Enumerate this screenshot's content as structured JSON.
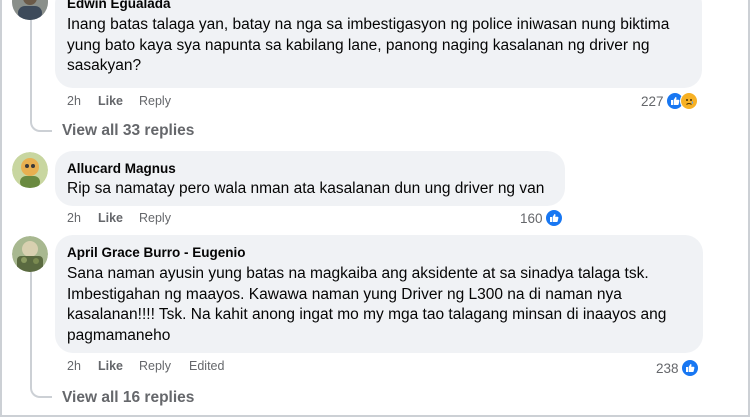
{
  "comments": [
    {
      "author": "Edwin Egualada",
      "text": "Inang batas talaga yan, batay na nga sa imbestigasyon ng police iniwasan nung biktima yung bato kaya sya napunta sa kabilang lane, panong naging kasalanan ng driver ng sasakyan?",
      "time": "2h",
      "like": "Like",
      "reply": "Reply",
      "reactions": "227",
      "reaction_icons": [
        "like-icon",
        "sad-icon"
      ],
      "view_replies": "View all 33 replies"
    },
    {
      "author": "Allucard Magnus",
      "text": "Rip sa namatay pero wala nman ata kasalanan dun ung driver ng van",
      "time": "2h",
      "like": "Like",
      "reply": "Reply",
      "reactions": "160",
      "reaction_icons": [
        "like-icon"
      ]
    },
    {
      "author": "April Grace Burro - Eugenio",
      "text": "Sana naman ayusin yung batas na magkaiba ang aksidente at sa sinadya talaga tsk. Imbestigahan ng maayos. Kawawa naman yung Driver ng L300 na di naman nya kasalanan!!!! Tsk. Na kahit anong ingat mo my mga tao talagang minsan di inaayos ang pagmamaneho",
      "time": "2h",
      "like": "Like",
      "reply": "Reply",
      "edited": "Edited",
      "reactions": "238",
      "reaction_icons": [
        "like-icon"
      ],
      "view_replies": "View all 16 replies"
    }
  ],
  "colors": {
    "bubble": "#f0f2f5",
    "meta": "#65676b",
    "like_blue": "#1877f2",
    "sad_yellow": "#f7b125",
    "thread_line": "#ccd0d5"
  }
}
